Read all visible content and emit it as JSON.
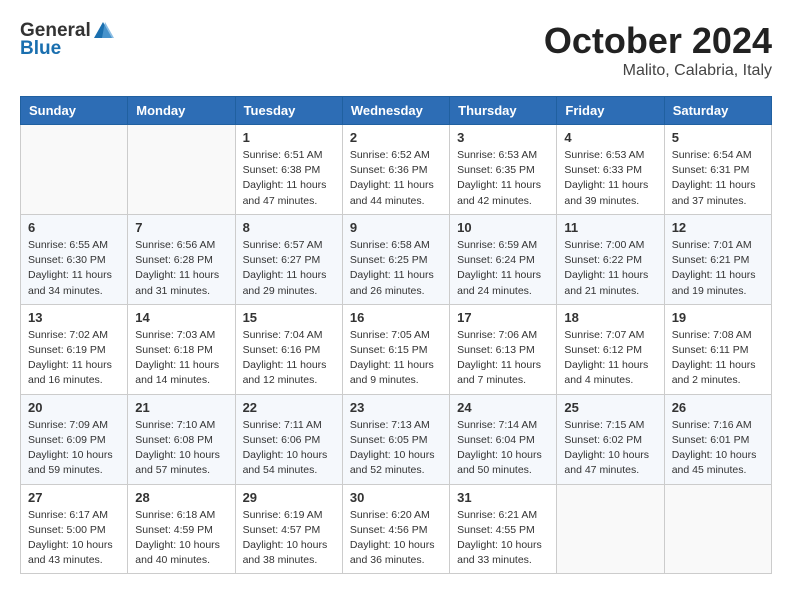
{
  "header": {
    "logo": {
      "general": "General",
      "blue": "Blue"
    },
    "title": "October 2024",
    "subtitle": "Malito, Calabria, Italy"
  },
  "weekdays": [
    "Sunday",
    "Monday",
    "Tuesday",
    "Wednesday",
    "Thursday",
    "Friday",
    "Saturday"
  ],
  "weeks": [
    [
      {
        "day": "",
        "content": ""
      },
      {
        "day": "",
        "content": ""
      },
      {
        "day": "1",
        "content": "Sunrise: 6:51 AM\nSunset: 6:38 PM\nDaylight: 11 hours and 47 minutes."
      },
      {
        "day": "2",
        "content": "Sunrise: 6:52 AM\nSunset: 6:36 PM\nDaylight: 11 hours and 44 minutes."
      },
      {
        "day": "3",
        "content": "Sunrise: 6:53 AM\nSunset: 6:35 PM\nDaylight: 11 hours and 42 minutes."
      },
      {
        "day": "4",
        "content": "Sunrise: 6:53 AM\nSunset: 6:33 PM\nDaylight: 11 hours and 39 minutes."
      },
      {
        "day": "5",
        "content": "Sunrise: 6:54 AM\nSunset: 6:31 PM\nDaylight: 11 hours and 37 minutes."
      }
    ],
    [
      {
        "day": "6",
        "content": "Sunrise: 6:55 AM\nSunset: 6:30 PM\nDaylight: 11 hours and 34 minutes."
      },
      {
        "day": "7",
        "content": "Sunrise: 6:56 AM\nSunset: 6:28 PM\nDaylight: 11 hours and 31 minutes."
      },
      {
        "day": "8",
        "content": "Sunrise: 6:57 AM\nSunset: 6:27 PM\nDaylight: 11 hours and 29 minutes."
      },
      {
        "day": "9",
        "content": "Sunrise: 6:58 AM\nSunset: 6:25 PM\nDaylight: 11 hours and 26 minutes."
      },
      {
        "day": "10",
        "content": "Sunrise: 6:59 AM\nSunset: 6:24 PM\nDaylight: 11 hours and 24 minutes."
      },
      {
        "day": "11",
        "content": "Sunrise: 7:00 AM\nSunset: 6:22 PM\nDaylight: 11 hours and 21 minutes."
      },
      {
        "day": "12",
        "content": "Sunrise: 7:01 AM\nSunset: 6:21 PM\nDaylight: 11 hours and 19 minutes."
      }
    ],
    [
      {
        "day": "13",
        "content": "Sunrise: 7:02 AM\nSunset: 6:19 PM\nDaylight: 11 hours and 16 minutes."
      },
      {
        "day": "14",
        "content": "Sunrise: 7:03 AM\nSunset: 6:18 PM\nDaylight: 11 hours and 14 minutes."
      },
      {
        "day": "15",
        "content": "Sunrise: 7:04 AM\nSunset: 6:16 PM\nDaylight: 11 hours and 12 minutes."
      },
      {
        "day": "16",
        "content": "Sunrise: 7:05 AM\nSunset: 6:15 PM\nDaylight: 11 hours and 9 minutes."
      },
      {
        "day": "17",
        "content": "Sunrise: 7:06 AM\nSunset: 6:13 PM\nDaylight: 11 hours and 7 minutes."
      },
      {
        "day": "18",
        "content": "Sunrise: 7:07 AM\nSunset: 6:12 PM\nDaylight: 11 hours and 4 minutes."
      },
      {
        "day": "19",
        "content": "Sunrise: 7:08 AM\nSunset: 6:11 PM\nDaylight: 11 hours and 2 minutes."
      }
    ],
    [
      {
        "day": "20",
        "content": "Sunrise: 7:09 AM\nSunset: 6:09 PM\nDaylight: 10 hours and 59 minutes."
      },
      {
        "day": "21",
        "content": "Sunrise: 7:10 AM\nSunset: 6:08 PM\nDaylight: 10 hours and 57 minutes."
      },
      {
        "day": "22",
        "content": "Sunrise: 7:11 AM\nSunset: 6:06 PM\nDaylight: 10 hours and 54 minutes."
      },
      {
        "day": "23",
        "content": "Sunrise: 7:13 AM\nSunset: 6:05 PM\nDaylight: 10 hours and 52 minutes."
      },
      {
        "day": "24",
        "content": "Sunrise: 7:14 AM\nSunset: 6:04 PM\nDaylight: 10 hours and 50 minutes."
      },
      {
        "day": "25",
        "content": "Sunrise: 7:15 AM\nSunset: 6:02 PM\nDaylight: 10 hours and 47 minutes."
      },
      {
        "day": "26",
        "content": "Sunrise: 7:16 AM\nSunset: 6:01 PM\nDaylight: 10 hours and 45 minutes."
      }
    ],
    [
      {
        "day": "27",
        "content": "Sunrise: 6:17 AM\nSunset: 5:00 PM\nDaylight: 10 hours and 43 minutes."
      },
      {
        "day": "28",
        "content": "Sunrise: 6:18 AM\nSunset: 4:59 PM\nDaylight: 10 hours and 40 minutes."
      },
      {
        "day": "29",
        "content": "Sunrise: 6:19 AM\nSunset: 4:57 PM\nDaylight: 10 hours and 38 minutes."
      },
      {
        "day": "30",
        "content": "Sunrise: 6:20 AM\nSunset: 4:56 PM\nDaylight: 10 hours and 36 minutes."
      },
      {
        "day": "31",
        "content": "Sunrise: 6:21 AM\nSunset: 4:55 PM\nDaylight: 10 hours and 33 minutes."
      },
      {
        "day": "",
        "content": ""
      },
      {
        "day": "",
        "content": ""
      }
    ]
  ]
}
